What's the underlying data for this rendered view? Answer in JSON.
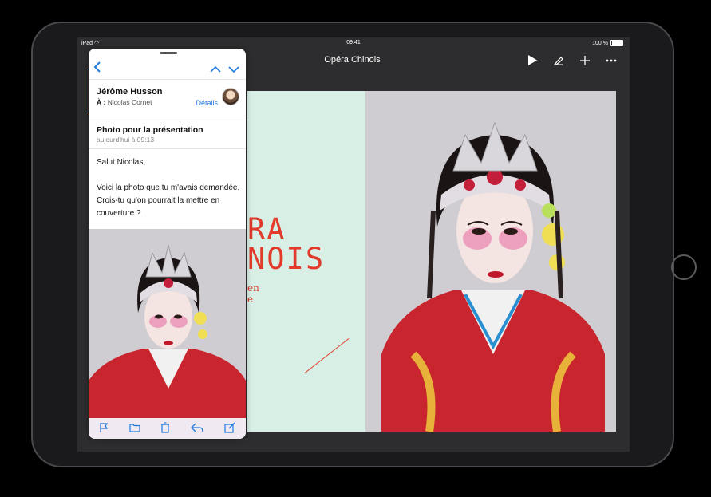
{
  "status_bar": {
    "device": "iPad",
    "time": "09:41",
    "battery": "100 %"
  },
  "document": {
    "title": "Opéra Chinois",
    "slide_title_line1": "RA",
    "slide_title_line2": "NOIS",
    "slide_subtitle_line1": "en",
    "slide_subtitle_line2": "e"
  },
  "mail": {
    "sender": "Jérôme Husson",
    "recipient_prefix": "À :",
    "recipient": "Nicolas Cornet",
    "details_link": "Détails",
    "subject": "Photo pour la présentation",
    "date": "aujourd'hui à 09:13",
    "greeting": "Salut Nicolas,",
    "body": "Voici la photo que tu m'avais demandée. Crois-tu qu'on pourrait la mettre en couverture ?"
  },
  "colors": {
    "accent_blue": "#1f7ae0",
    "slide_red": "#e23b2b",
    "slide_mint": "#d8efe6"
  },
  "icons": {
    "toolbar": [
      "play-icon",
      "brush-icon",
      "plus-icon",
      "more-icon"
    ],
    "mail_nav": [
      "back-chevron-icon",
      "up-chevron-icon",
      "down-chevron-icon"
    ],
    "mail_toolbar": [
      "flag-icon",
      "folder-icon",
      "trash-icon",
      "reply-icon",
      "compose-icon"
    ]
  }
}
